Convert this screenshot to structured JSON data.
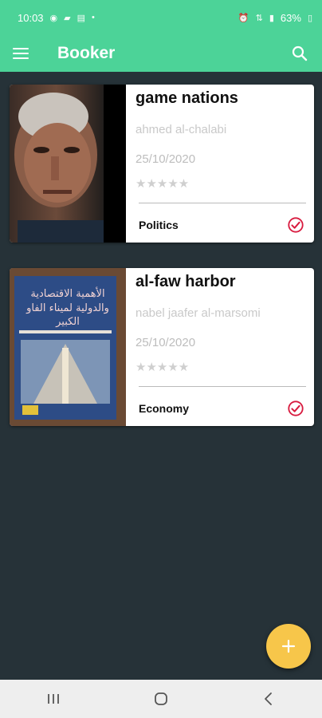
{
  "status_bar": {
    "time": "10:03",
    "battery": "63%"
  },
  "app_bar": {
    "title": "Booker"
  },
  "books": [
    {
      "title": "game nations",
      "author": "ahmed al-chalabi",
      "date": "25/10/2020",
      "stars": "★★★★★",
      "category": "Politics"
    },
    {
      "title": "al-faw harbor",
      "author": "nabel jaafer al-marsomi",
      "date": "25/10/2020",
      "stars": "★★★★★",
      "category": "Economy",
      "cover_text": "الأهمية الاقتصادية والدولية لميناء الفاو الكبير"
    }
  ],
  "colors": {
    "primary": "#4cd398",
    "background": "#263238",
    "fab": "#f7c64a",
    "check": "#d81b3f"
  },
  "icons": {
    "menu": "menu-icon",
    "search": "search-icon",
    "check": "check-circle-icon",
    "add": "plus-icon",
    "recents": "recents-icon",
    "home": "home-icon",
    "back": "back-icon"
  }
}
